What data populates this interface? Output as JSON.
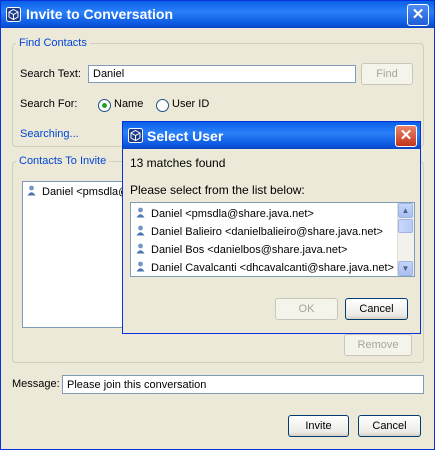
{
  "main": {
    "title": "Invite to Conversation",
    "find_contacts": {
      "legend": "Find Contacts",
      "search_text_label": "Search Text:",
      "search_text_value": "Daniel",
      "find_button": "Find",
      "search_for_label": "Search For:",
      "option_name": "Name",
      "option_user_id": "User ID",
      "selected_option": "Name",
      "status": "Searching..."
    },
    "contacts_to_invite": {
      "legend": "Contacts To Invite",
      "items": [
        "Daniel <pmsdla@"
      ],
      "remove_button": "Remove"
    },
    "message_label": "Message:",
    "message_value": "Please join this conversation",
    "invite_button": "Invite",
    "cancel_button": "Cancel"
  },
  "dialog": {
    "title": "Select User",
    "matches": "13 matches found",
    "prompt": "Please select from the list below:",
    "users": [
      "Daniel <pmsdla@share.java.net>",
      "Daniel Balieiro <danielbalieiro@share.java.net>",
      "Daniel Bos <danielbos@share.java.net>",
      "Daniel Cavalcanti <dhcavalcanti@share.java.net>"
    ],
    "ok_button": "OK",
    "cancel_button": "Cancel"
  },
  "colors": {
    "titlebar": "#0a5fe8",
    "legend": "#0046d5",
    "status": "#0046d5",
    "dialog_close": "#c2351a"
  },
  "icons": {
    "app": "cube-logo-icon",
    "close": "close-icon",
    "user": "user-icon"
  }
}
